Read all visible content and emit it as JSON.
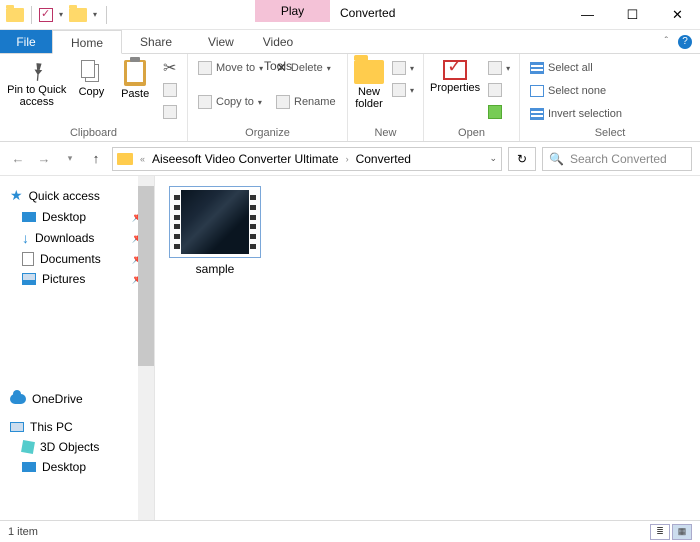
{
  "titlebar": {
    "play_tab": "Play",
    "title": "Converted"
  },
  "menurow": {
    "file": "File",
    "home": "Home",
    "share": "Share",
    "view": "View",
    "video_tools": "Video Tools"
  },
  "ribbon": {
    "clipboard": {
      "pin": "Pin to Quick access",
      "copy": "Copy",
      "paste": "Paste",
      "label": "Clipboard"
    },
    "organize": {
      "move": "Move to",
      "copy": "Copy to",
      "delete": "Delete",
      "rename": "Rename",
      "label": "Organize"
    },
    "new": {
      "folder": "New folder",
      "label": "New"
    },
    "open": {
      "properties": "Properties",
      "label": "Open"
    },
    "select": {
      "all": "Select all",
      "none": "Select none",
      "invert": "Invert selection",
      "label": "Select"
    }
  },
  "address": {
    "part1": "Aiseesoft Video Converter Ultimate",
    "part2": "Converted"
  },
  "search": {
    "placeholder": "Search Converted"
  },
  "sidebar": {
    "quick": "Quick access",
    "desktop": "Desktop",
    "downloads": "Downloads",
    "documents": "Documents",
    "pictures": "Pictures",
    "onedrive": "OneDrive",
    "thispc": "This PC",
    "objects3d": "3D Objects",
    "desktop2": "Desktop"
  },
  "files": {
    "item1": "sample"
  },
  "status": {
    "count": "1 item"
  }
}
